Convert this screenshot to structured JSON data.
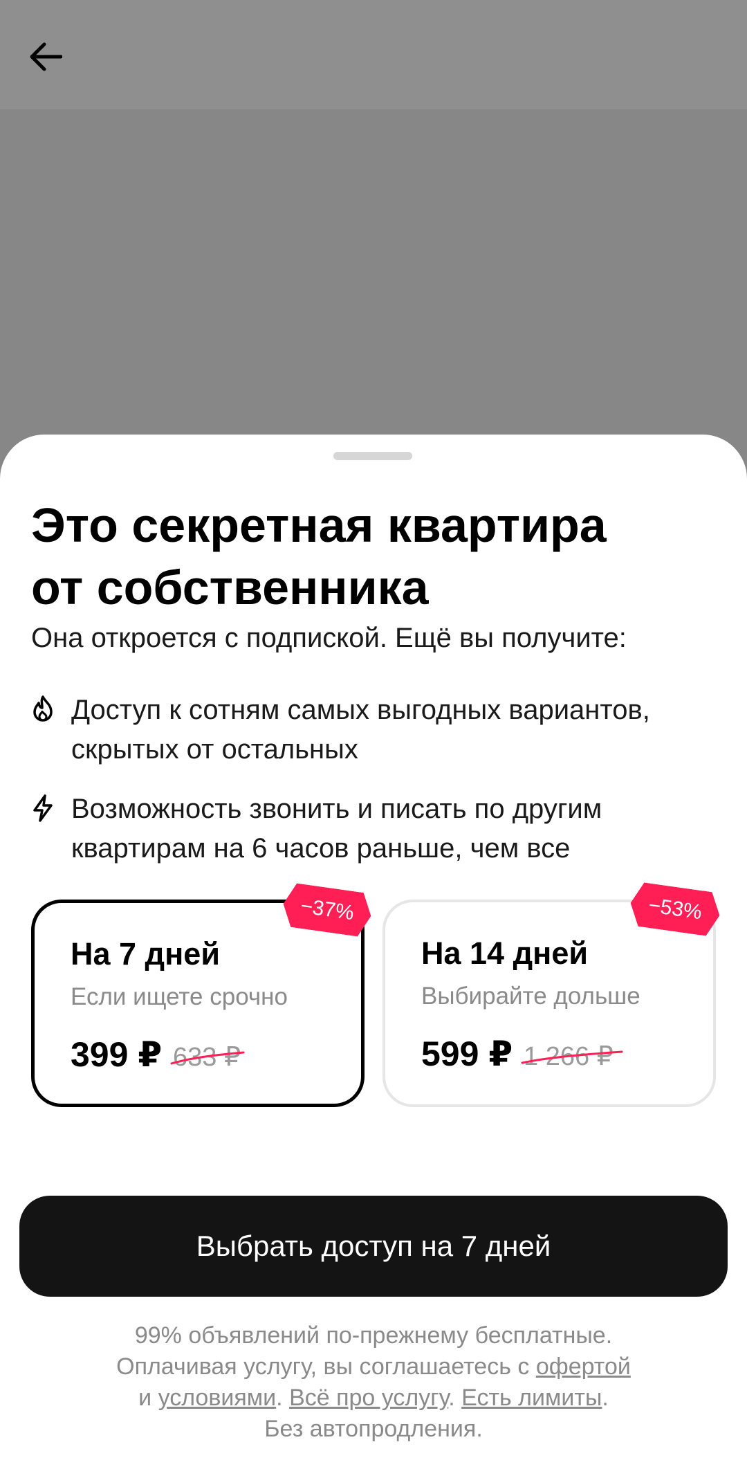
{
  "header": {
    "back_icon": "arrow-left-icon"
  },
  "sheet": {
    "title_line1": "Это секретная квартира",
    "title_line2": "от собственника",
    "subtitle": "Она откроется с подпиской. Ещё вы получите:",
    "features": [
      {
        "icon": "flame-icon",
        "line1": "Доступ к сотням самых выгодных вариантов,",
        "line2": "скрытых от остальных"
      },
      {
        "icon": "lightning-icon",
        "line1": "Возможность звонить и писать по другим",
        "line2": "квартирам на 6 часов раньше, чем все"
      }
    ],
    "plans": [
      {
        "name": "На 7 дней",
        "description": "Если ищете срочно",
        "price": "399 ₽",
        "old_price": "633 ₽",
        "discount": "−37%",
        "selected": true
      },
      {
        "name": "На 14 дней",
        "description": "Выбирайте дольше",
        "price": "599 ₽",
        "old_price": "1 266 ₽",
        "discount": "−53%",
        "selected": false
      }
    ],
    "cta_label": "Выбрать доступ на 7 дней",
    "footer": {
      "line1": "99% объявлений по-прежнему бесплатные.",
      "line2_prefix": "Оплачивая услугу, вы соглашаетесь с ",
      "offer_link": "офертой",
      "line3_prefix": "и ",
      "terms_link": "условиями",
      "about_link": "Всё про услугу",
      "limits_link": "Есть лимиты",
      "line4": "Без автопродления."
    }
  },
  "colors": {
    "backdrop": "#8c8c8c",
    "badge": "#ff1f55",
    "cta_bg": "#141414",
    "muted_text": "#8a8a8a"
  }
}
